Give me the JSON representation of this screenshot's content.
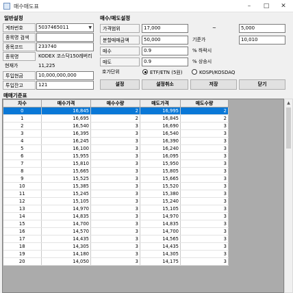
{
  "window": {
    "title": "매수매도표",
    "minimize": "–",
    "maximize": "□",
    "close": "✕"
  },
  "general": {
    "section_title": "일반설정",
    "account": {
      "label": "계좌번호",
      "value": "5037465011"
    },
    "name_search": {
      "label": "종목명 검색",
      "value": ""
    },
    "code": {
      "label": "종목코드",
      "value": "233740"
    },
    "stock_name": {
      "label": "종목명",
      "value": "KODEX 코스닥150레버리"
    },
    "current_price": {
      "label": "현재가",
      "value": "11,225"
    },
    "invest_amount": {
      "label": "투입현금",
      "value": "10,000,000,000"
    },
    "invest_balance": {
      "label": "투입잔고",
      "value": "121"
    }
  },
  "trade": {
    "section_title": "매수/매도설정",
    "price_range": {
      "label": "가격범위",
      "from": "17,000",
      "sep": "~",
      "to": "5,000"
    },
    "split_amount": {
      "label": "분할매매금액",
      "value": "50,000",
      "base_label": "기준가",
      "base_value": "10,010"
    },
    "buy": {
      "label": "매수",
      "value": "0.9",
      "unit": "% 하락시"
    },
    "sell": {
      "label": "매도",
      "value": "0.9",
      "unit": "% 상승시"
    },
    "tick": {
      "label": "호가단위",
      "option1": "ETF/ETN (5원)",
      "option2": "KOSPI/KOSDAQ",
      "selected": "ETF/ETN (5원)"
    },
    "buttons": {
      "set": "설정",
      "cancel": "설정취소",
      "save": "저장",
      "close": "닫기"
    }
  },
  "table": {
    "section_title": "매매기준표",
    "headers": [
      "차수",
      "매수가격",
      "매수수량",
      "매도가격",
      "매도수량"
    ],
    "rows": [
      [
        "0",
        "16,845",
        "2",
        "16,995",
        "2"
      ],
      [
        "1",
        "16,695",
        "2",
        "16,845",
        "2"
      ],
      [
        "2",
        "16,540",
        "3",
        "16,690",
        "3"
      ],
      [
        "3",
        "16,395",
        "3",
        "16,540",
        "3"
      ],
      [
        "4",
        "16,245",
        "3",
        "16,390",
        "3"
      ],
      [
        "5",
        "16,100",
        "3",
        "16,240",
        "3"
      ],
      [
        "6",
        "15,955",
        "3",
        "16,095",
        "3"
      ],
      [
        "7",
        "15,810",
        "3",
        "15,950",
        "3"
      ],
      [
        "8",
        "15,665",
        "3",
        "15,805",
        "3"
      ],
      [
        "9",
        "15,525",
        "3",
        "15,665",
        "3"
      ],
      [
        "10",
        "15,385",
        "3",
        "15,520",
        "3"
      ],
      [
        "11",
        "15,245",
        "3",
        "15,380",
        "3"
      ],
      [
        "12",
        "15,105",
        "3",
        "15,240",
        "3"
      ],
      [
        "13",
        "14,970",
        "3",
        "15,105",
        "3"
      ],
      [
        "14",
        "14,835",
        "3",
        "14,970",
        "3"
      ],
      [
        "15",
        "14,700",
        "3",
        "14,835",
        "3"
      ],
      [
        "16",
        "14,570",
        "3",
        "14,700",
        "3"
      ],
      [
        "17",
        "14,435",
        "3",
        "14,565",
        "3"
      ],
      [
        "18",
        "14,305",
        "3",
        "14,435",
        "3"
      ],
      [
        "19",
        "14,180",
        "3",
        "14,305",
        "3"
      ],
      [
        "20",
        "14,050",
        "3",
        "14,175",
        "3"
      ]
    ]
  }
}
